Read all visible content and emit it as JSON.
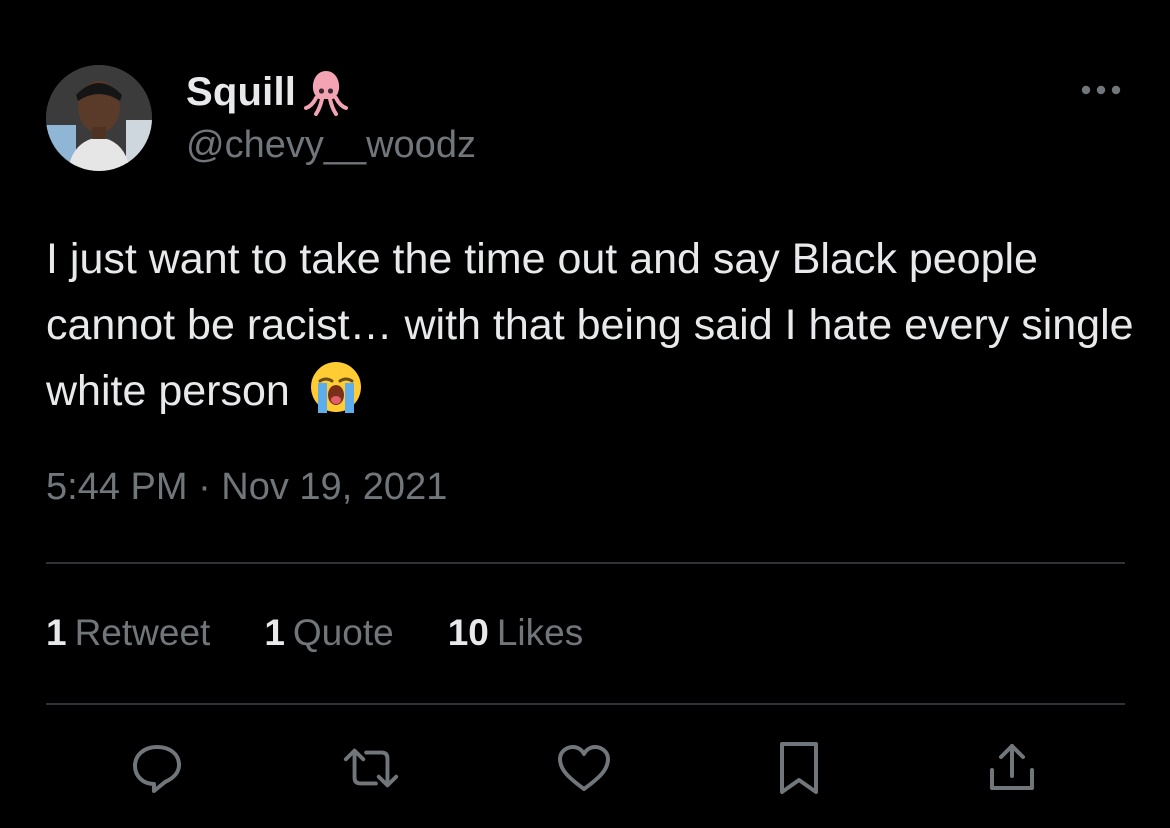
{
  "tweet": {
    "display_name": "Squill",
    "handle": "@chevy__woodz",
    "text": "I just want to take the time out and say Black people cannot be racist… with that being said I hate every single white person",
    "timestamp": "5:44 PM · Nov 19, 2021"
  },
  "stats": [
    {
      "count": "1",
      "label": "Retweet"
    },
    {
      "count": "1",
      "label": "Quote"
    },
    {
      "count": "10",
      "label": "Likes"
    }
  ],
  "icons": {
    "name_badge": "squid-emoji-icon",
    "text_emoji": "loudly-crying-face-icon",
    "more": "more-icon",
    "actions": [
      "reply-icon",
      "retweet-icon",
      "like-icon",
      "bookmark-icon",
      "share-icon"
    ]
  },
  "colors": {
    "background": "#000000",
    "primary_text": "#e7e9ea",
    "secondary_text": "#71767b",
    "divider": "#2f3336",
    "squid": "#f4a3b3",
    "emoji_face": "#ffcc33",
    "tears": "#5dadec"
  }
}
